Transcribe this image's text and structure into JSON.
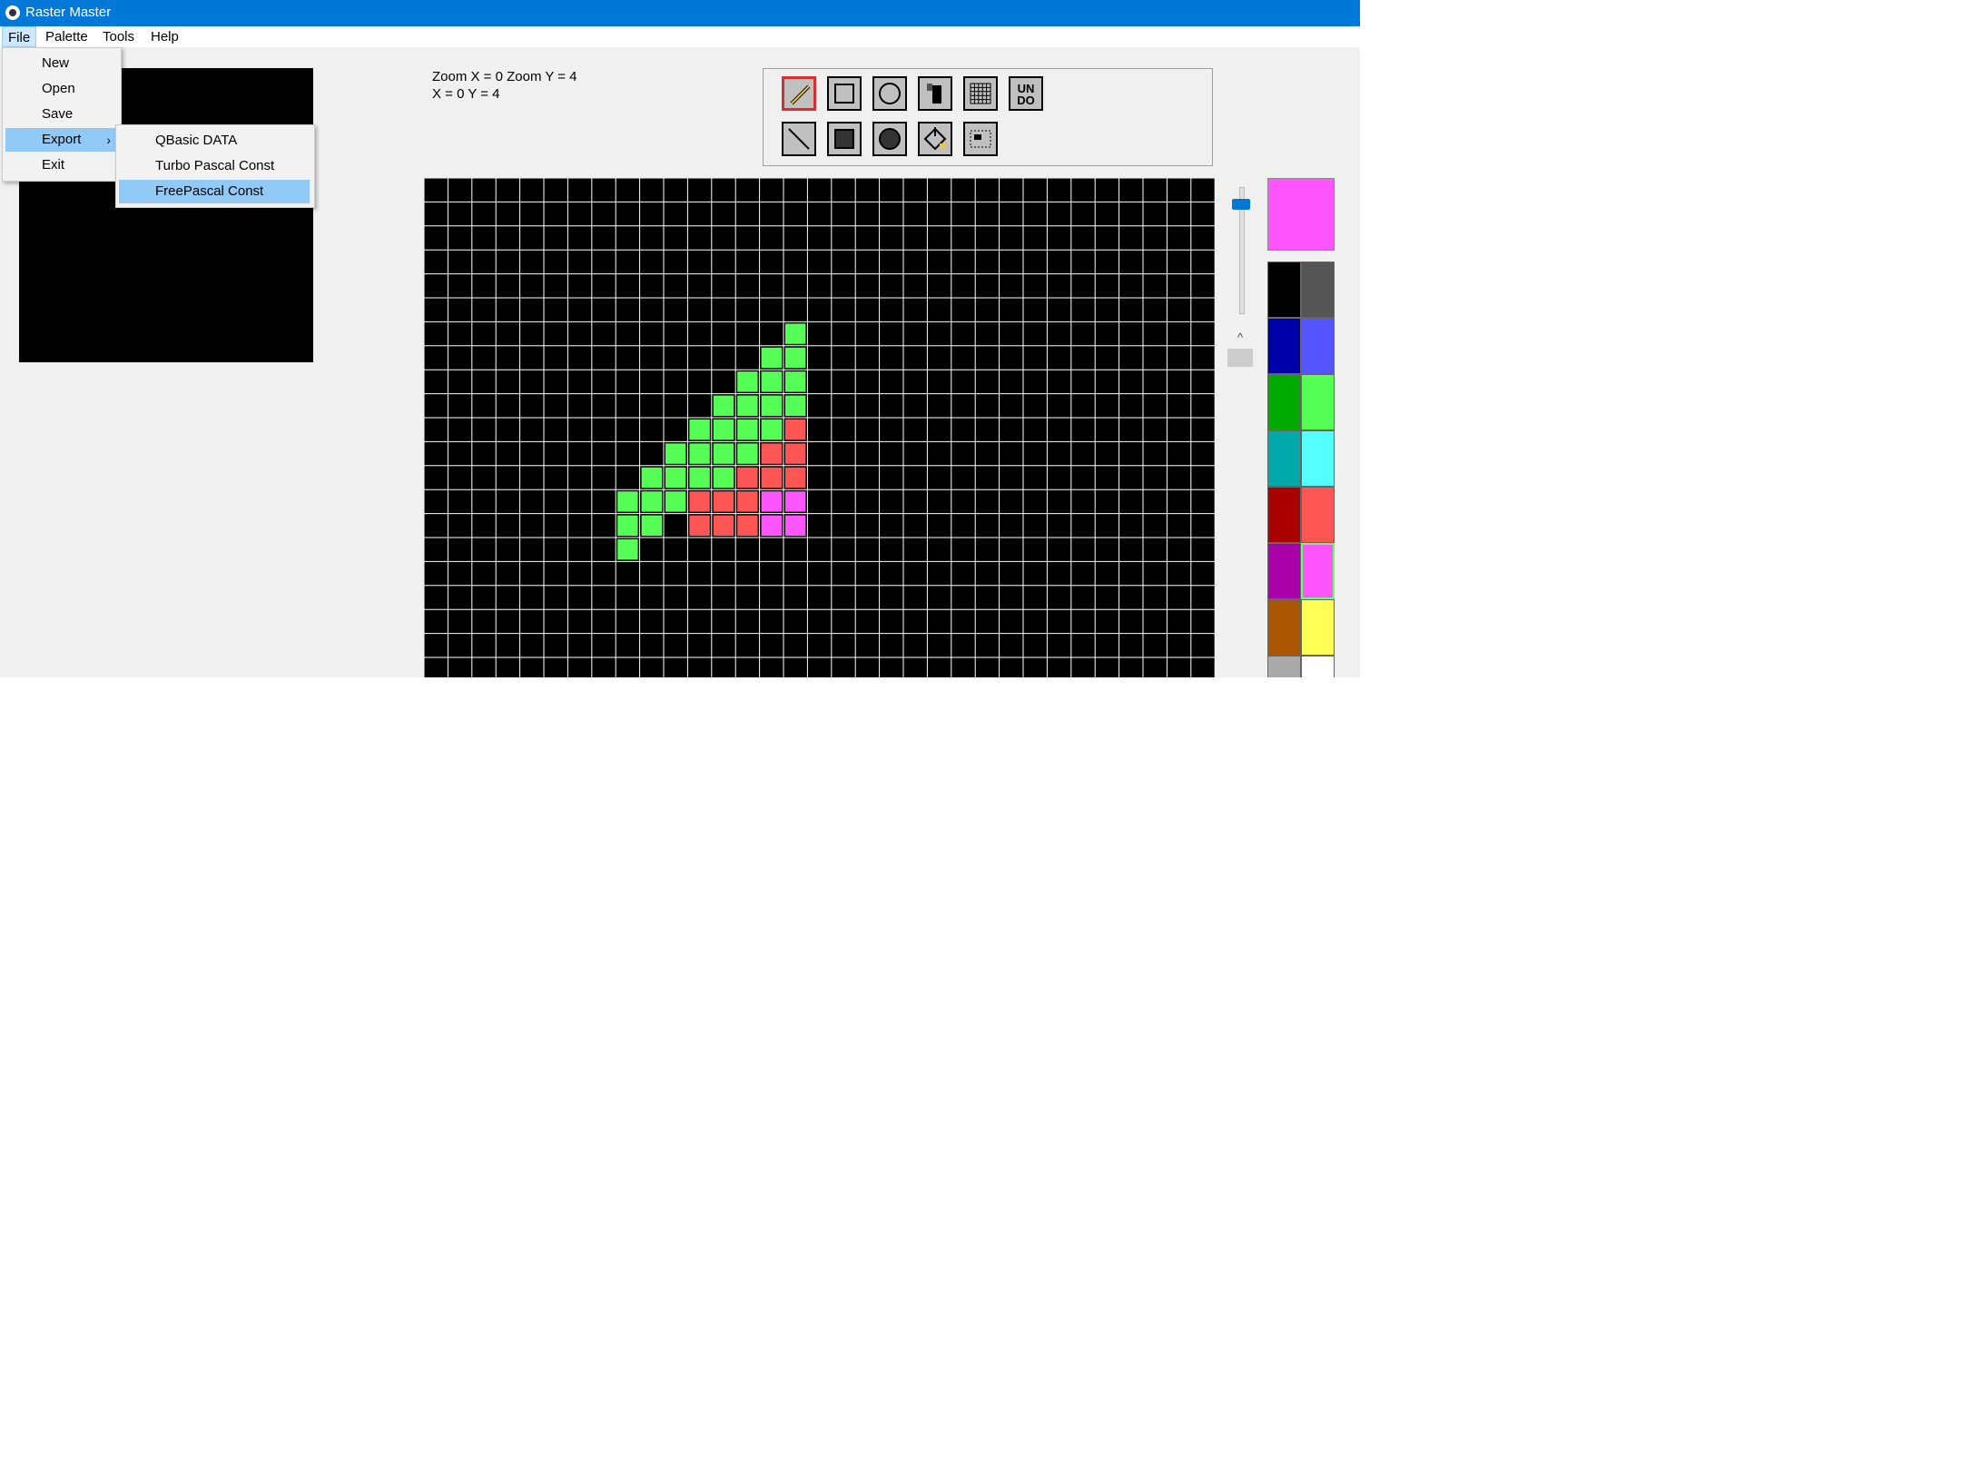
{
  "window": {
    "title": "Raster Master"
  },
  "menubar": {
    "items": [
      "File",
      "Palette",
      "Tools",
      "Help"
    ]
  },
  "file_menu": {
    "items": [
      "New",
      "Open",
      "Save",
      "Export",
      "Exit"
    ],
    "highlighted": "Export"
  },
  "export_submenu": {
    "items": [
      "QBasic DATA",
      "Turbo Pascal Const",
      "FreePascal Const"
    ],
    "highlighted": "FreePascal Const"
  },
  "status": {
    "zoom_line": "Zoom X = 0 Zoom Y = 4",
    "pos_line": "X = 0 Y = 4"
  },
  "tools": [
    {
      "icon": "pencil-icon",
      "selected": true
    },
    {
      "icon": "rectangle-outline-icon",
      "selected": false
    },
    {
      "icon": "circle-outline-icon",
      "selected": false
    },
    {
      "icon": "paint-bucket-icon",
      "selected": false
    },
    {
      "icon": "grid-icon",
      "selected": false
    },
    {
      "icon": "undo-icon",
      "label": "UN DO",
      "selected": false
    },
    {
      "icon": "line-icon",
      "selected": false
    },
    {
      "icon": "rectangle-filled-icon",
      "selected": false
    },
    {
      "icon": "circle-filled-icon",
      "selected": false
    },
    {
      "icon": "fill-icon",
      "selected": false
    },
    {
      "icon": "select-icon",
      "selected": false
    }
  ],
  "current_color": "#ff55ff",
  "palette": [
    "#000000",
    "#555555",
    "#0000aa",
    "#5555ff",
    "#00aa00",
    "#55ff55",
    "#00aaaa",
    "#55ffff",
    "#aa0000",
    "#ff5555",
    "#aa00aa",
    "#ff55ff",
    "#aa5500",
    "#ffff55",
    "#aaaaaa",
    "#ffffff"
  ],
  "selected_palette_index": 11,
  "canvas": {
    "grid_color": "#ffffff",
    "background": "#000000",
    "pixels": [
      {
        "row": 6,
        "col": 15,
        "color": "#55ff55"
      },
      {
        "row": 7,
        "col": 14,
        "color": "#55ff55"
      },
      {
        "row": 7,
        "col": 15,
        "color": "#55ff55"
      },
      {
        "row": 8,
        "col": 13,
        "color": "#55ff55"
      },
      {
        "row": 8,
        "col": 14,
        "color": "#55ff55"
      },
      {
        "row": 8,
        "col": 15,
        "color": "#55ff55"
      },
      {
        "row": 9,
        "col": 12,
        "color": "#55ff55"
      },
      {
        "row": 9,
        "col": 13,
        "color": "#55ff55"
      },
      {
        "row": 9,
        "col": 14,
        "color": "#55ff55"
      },
      {
        "row": 9,
        "col": 15,
        "color": "#55ff55"
      },
      {
        "row": 10,
        "col": 11,
        "color": "#55ff55"
      },
      {
        "row": 10,
        "col": 12,
        "color": "#55ff55"
      },
      {
        "row": 10,
        "col": 13,
        "color": "#55ff55"
      },
      {
        "row": 10,
        "col": 14,
        "color": "#55ff55"
      },
      {
        "row": 10,
        "col": 15,
        "color": "#ff5555"
      },
      {
        "row": 11,
        "col": 10,
        "color": "#55ff55"
      },
      {
        "row": 11,
        "col": 11,
        "color": "#55ff55"
      },
      {
        "row": 11,
        "col": 12,
        "color": "#55ff55"
      },
      {
        "row": 11,
        "col": 13,
        "color": "#55ff55"
      },
      {
        "row": 11,
        "col": 14,
        "color": "#ff5555"
      },
      {
        "row": 11,
        "col": 15,
        "color": "#ff5555"
      },
      {
        "row": 12,
        "col": 9,
        "color": "#55ff55"
      },
      {
        "row": 12,
        "col": 10,
        "color": "#55ff55"
      },
      {
        "row": 12,
        "col": 11,
        "color": "#55ff55"
      },
      {
        "row": 12,
        "col": 12,
        "color": "#55ff55"
      },
      {
        "row": 12,
        "col": 13,
        "color": "#ff5555"
      },
      {
        "row": 12,
        "col": 14,
        "color": "#ff5555"
      },
      {
        "row": 12,
        "col": 15,
        "color": "#ff5555"
      },
      {
        "row": 13,
        "col": 8,
        "color": "#55ff55"
      },
      {
        "row": 13,
        "col": 9,
        "color": "#55ff55"
      },
      {
        "row": 13,
        "col": 10,
        "color": "#55ff55"
      },
      {
        "row": 13,
        "col": 11,
        "color": "#ff5555"
      },
      {
        "row": 13,
        "col": 12,
        "color": "#ff5555"
      },
      {
        "row": 13,
        "col": 13,
        "color": "#ff5555"
      },
      {
        "row": 13,
        "col": 14,
        "color": "#ff55ff"
      },
      {
        "row": 13,
        "col": 15,
        "color": "#ff55ff"
      },
      {
        "row": 14,
        "col": 8,
        "color": "#55ff55"
      },
      {
        "row": 14,
        "col": 9,
        "color": "#55ff55"
      },
      {
        "row": 14,
        "col": 11,
        "color": "#ff5555"
      },
      {
        "row": 14,
        "col": 12,
        "color": "#ff5555"
      },
      {
        "row": 14,
        "col": 13,
        "color": "#ff5555"
      },
      {
        "row": 14,
        "col": 14,
        "color": "#ff55ff"
      },
      {
        "row": 14,
        "col": 15,
        "color": "#ff55ff"
      },
      {
        "row": 15,
        "col": 8,
        "color": "#55ff55"
      }
    ]
  }
}
